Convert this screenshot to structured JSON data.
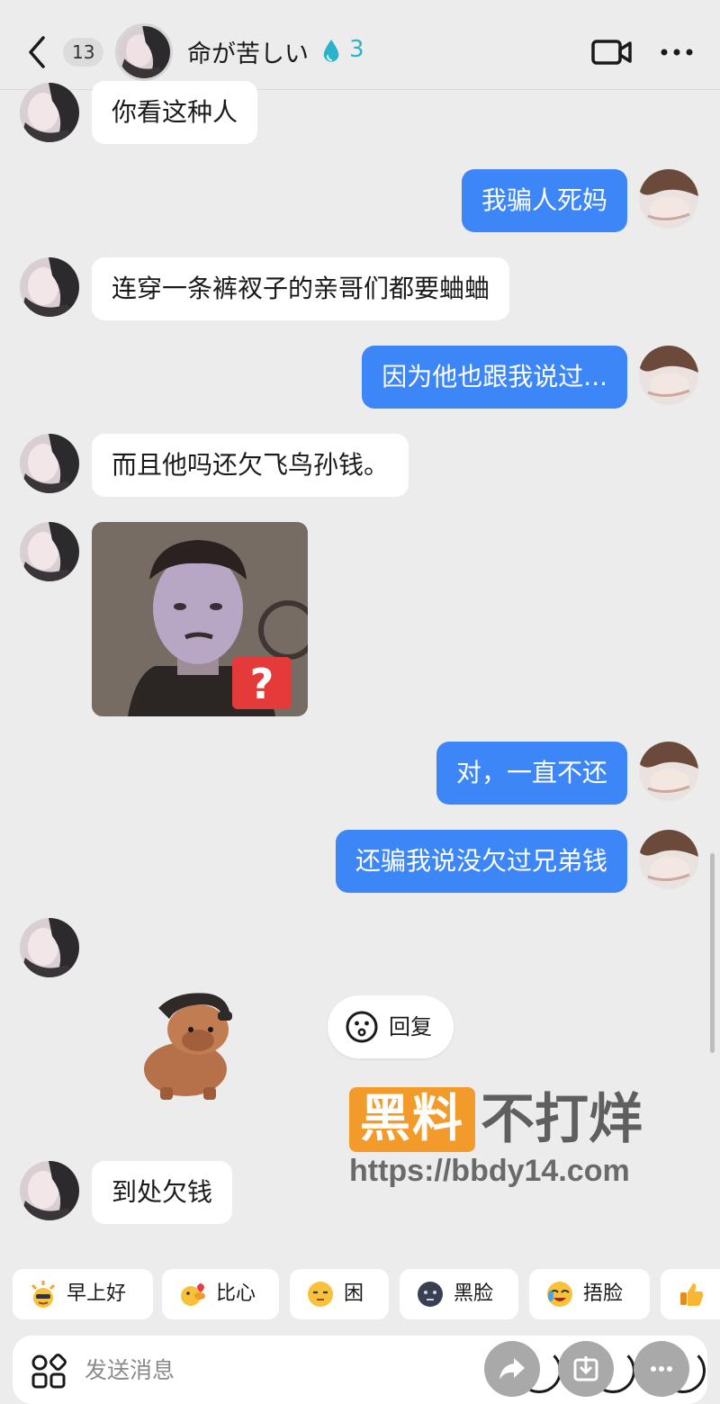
{
  "header": {
    "unread_count": "13",
    "title": "命が苦しい",
    "spark_count": "3",
    "icons": [
      "back-icon",
      "video-call-icon",
      "more-icon",
      "water-drop-icon"
    ]
  },
  "messages": [
    {
      "side": "left",
      "text": "你看这种人"
    },
    {
      "side": "right",
      "text": "我骗人死妈"
    },
    {
      "side": "left",
      "text": "连穿一条裤衩子的亲哥们都要蛐蛐"
    },
    {
      "side": "right",
      "text": "因为他也跟我说过..."
    },
    {
      "side": "left",
      "text": "而且他吗还欠飞鸟孙钱。"
    },
    {
      "side": "left",
      "type": "image",
      "text": "?"
    },
    {
      "side": "right",
      "text": "对，一直不还"
    },
    {
      "side": "right",
      "text": "还骗我说没欠过兄弟钱"
    },
    {
      "side": "left",
      "type": "sticker"
    },
    {
      "side": "left",
      "text": "到处欠钱"
    }
  ],
  "reply_action": {
    "label": "回复",
    "icon": "smiley-icon"
  },
  "watermark": {
    "logo": "黑料",
    "title": "不打烊",
    "url": "https://bbdy14.com",
    "logo_color": "#f39b2a"
  },
  "quick_replies": [
    {
      "label": "早上好",
      "icon": "sun-face-emoji"
    },
    {
      "label": "比心",
      "icon": "duck-heart-emoji"
    },
    {
      "label": "困",
      "icon": "sleepy-face-emoji"
    },
    {
      "label": "黑脸",
      "icon": "dark-face-emoji"
    },
    {
      "label": "捂脸",
      "icon": "face-palm-emoji"
    },
    {
      "label": "",
      "icon": "thumbs-up-emoji"
    }
  ],
  "input": {
    "placeholder": "发送消息"
  },
  "colors": {
    "my_bubble": "#3d86f7",
    "their_bubble": "#ffffff",
    "background": "#ececec",
    "accent_teal": "#2bb3c9"
  }
}
